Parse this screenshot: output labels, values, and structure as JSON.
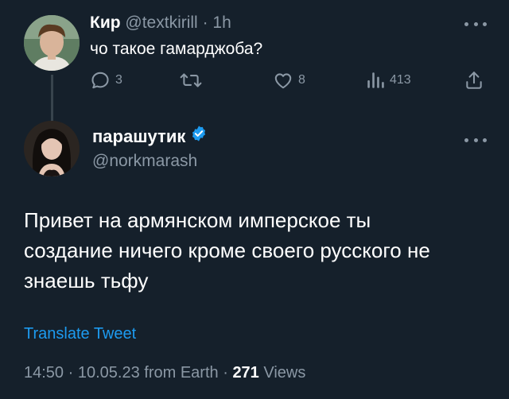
{
  "reply": {
    "author_name": "Кир",
    "author_handle": "@textkirill",
    "separator": "·",
    "time": "1h",
    "text": "чо такое гамарджоба?",
    "replies_count": "3",
    "likes_count": "8",
    "views_count": "413",
    "icons": [
      "reply-icon",
      "retweet-icon",
      "like-icon",
      "views-icon",
      "share-icon",
      "more-icon"
    ]
  },
  "main": {
    "author_name": "парашутик",
    "author_handle": "@norkmarash",
    "verified": true,
    "text": "Привет на армянском имперское ты\nсоздание ничего кроме своего русского не\nзнаешь тьфу",
    "translate_label": "Translate Tweet",
    "time": "14:50",
    "dot": "·",
    "date": "10.05.23",
    "source": "from Earth",
    "views_count": "271",
    "views_label": "Views"
  },
  "colors": {
    "background": "#15202b",
    "muted": "#8b98a5",
    "accent": "#1d9bf0",
    "thread_line": "#38444d"
  }
}
